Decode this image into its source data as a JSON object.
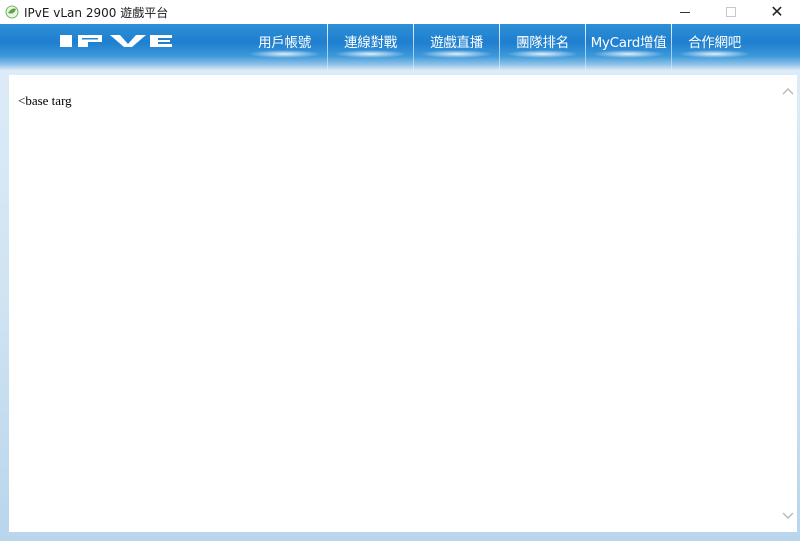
{
  "window": {
    "title": "IPvE vLan 2900 遊戲平台",
    "icon": "leaf-app-icon"
  },
  "header": {
    "logo": "IPVE",
    "nav": [
      {
        "label": "用戶帳號"
      },
      {
        "label": "連線對戰"
      },
      {
        "label": "遊戲直播"
      },
      {
        "label": "團隊排名"
      },
      {
        "label": "MyCard增值"
      },
      {
        "label": "合作網吧"
      }
    ]
  },
  "content": {
    "text": "<base targ"
  },
  "colors": {
    "header_blue": "#1f7fcf",
    "nav_text": "#ffffff",
    "frame_bg": "#cfe3f3"
  }
}
